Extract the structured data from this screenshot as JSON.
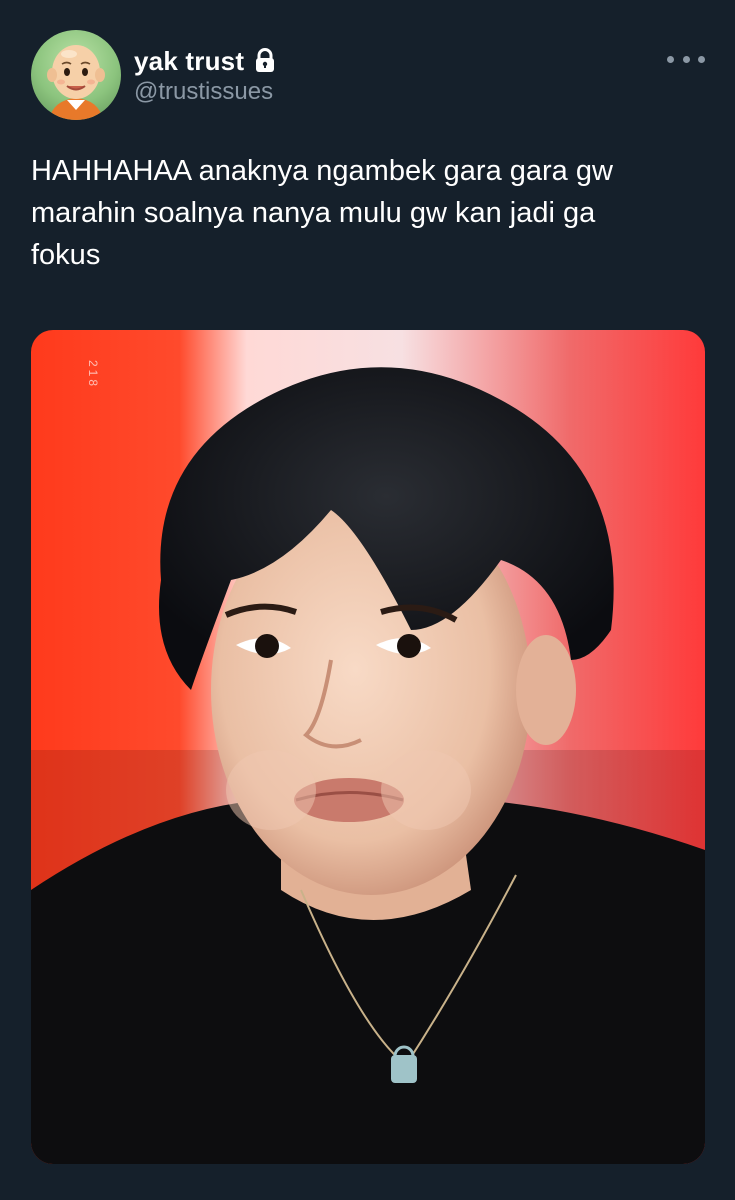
{
  "tweet": {
    "author": {
      "display_name": "yak trust",
      "handle": "@trustissues",
      "protected_icon": "lock-icon",
      "avatar": "avatar-cartoon-boy"
    },
    "more_icon": "more-horizontal-icon",
    "text": "HAHHAHAA anaknya ngambek gara gara gw\nmarahin soalnya nanya mulu gw kan jadi ga\nfokus",
    "media": {
      "kind": "photo",
      "watermark": "218"
    }
  },
  "colors": {
    "background": "#15202b",
    "primary_text": "#ffffff",
    "secondary_text": "#8b98a5"
  }
}
